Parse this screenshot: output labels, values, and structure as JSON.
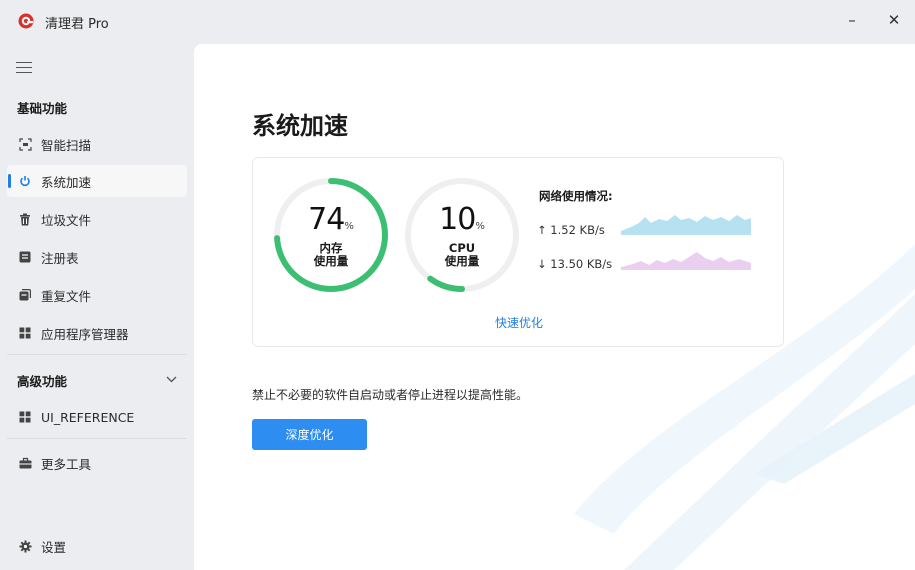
{
  "window": {
    "title": "清理君 Pro",
    "minimize_glyph": "–",
    "close_glyph": "✕"
  },
  "sidebar": {
    "section_basic": "基础功能",
    "items": [
      {
        "label": "智能扫描",
        "icon": "scan-icon"
      },
      {
        "label": "系统加速",
        "icon": "power-icon",
        "active": true
      },
      {
        "label": "垃圾文件",
        "icon": "trash-icon"
      },
      {
        "label": "注册表",
        "icon": "registry-icon"
      },
      {
        "label": "重复文件",
        "icon": "duplicate-file-icon"
      },
      {
        "label": "应用程序管理器",
        "icon": "apps-grid-icon"
      }
    ],
    "section_advanced": "高级功能",
    "advanced_items": [
      {
        "label": "UI_REFERENCE",
        "icon": "apps-grid-icon"
      }
    ],
    "more_tools": "更多工具",
    "settings": "设置"
  },
  "main": {
    "title": "系统加速",
    "memory": {
      "value": "74",
      "unit": "%",
      "label1": "内存",
      "label2": "使用量",
      "percent": 74
    },
    "cpu": {
      "value": "10",
      "unit": "%",
      "label1": "CPU",
      "label2": "使用量",
      "percent": 10
    },
    "network": {
      "title": "网络使用情况:",
      "upload": "↑ 1.52 KB/s",
      "download": "↓ 13.50 KB/s"
    },
    "quick_optimize": "快速优化",
    "description": "禁止不必要的软件自启动或者停止进程以提高性能。",
    "deep_optimize": "深度优化"
  },
  "colors": {
    "accent": "#2e8df0",
    "gauge_green": "#3dbf73",
    "upload_spark": "#a9dcef",
    "download_spark": "#e8c7ee"
  }
}
